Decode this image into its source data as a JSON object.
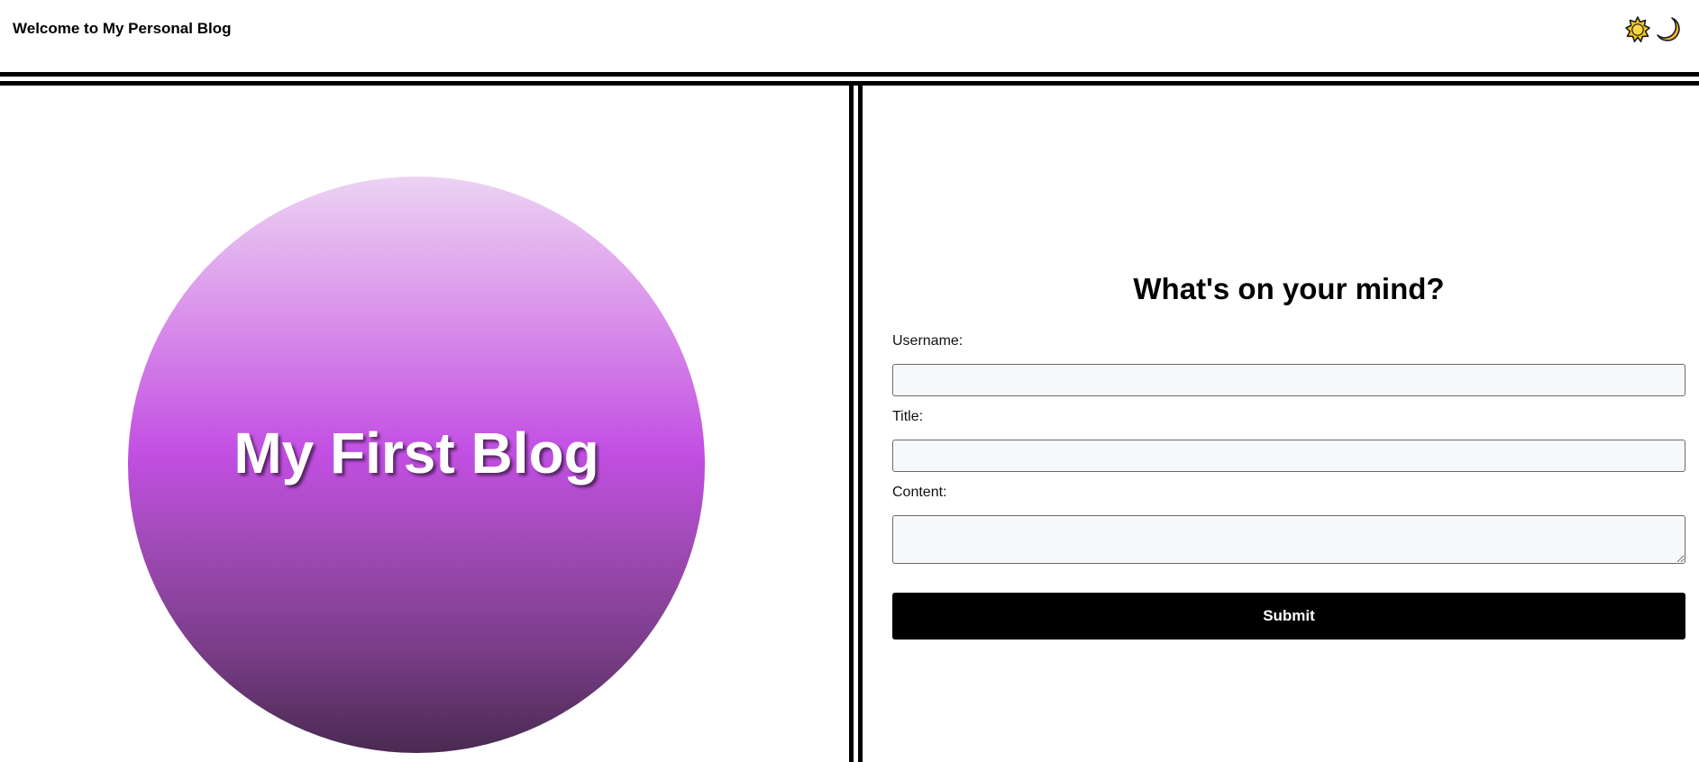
{
  "header": {
    "site_title": "Welcome to My Personal Blog",
    "theme_icons": [
      "sun-icon",
      "moon-icon"
    ]
  },
  "hero": {
    "title": "My First Blog",
    "gradient_colors": [
      "#ecd3f3",
      "#c24fe3",
      "#4a2a52"
    ]
  },
  "form": {
    "heading": "What's on your mind?",
    "username_label": "Username:",
    "username_value": "",
    "title_label": "Title:",
    "title_value": "",
    "content_label": "Content:",
    "content_value": "",
    "submit_label": "Submit"
  },
  "colors": {
    "accent": "#000000",
    "sun": "#f5c518",
    "moon": "#f2b632"
  }
}
